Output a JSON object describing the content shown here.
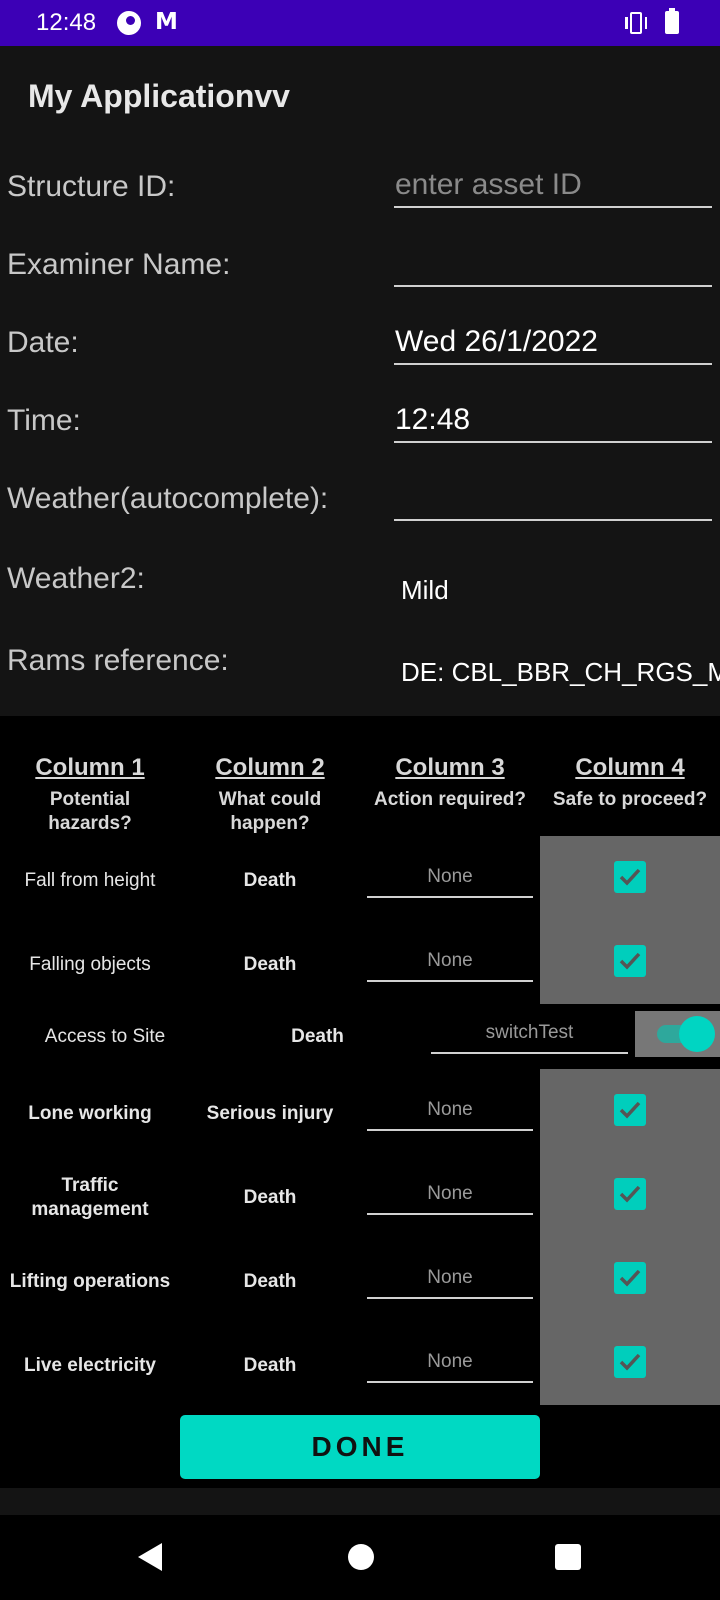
{
  "status_bar": {
    "time": "12:48",
    "mail_icon_glyph": "M",
    "icons": [
      "pocket-casts-icon",
      "gmail-icon",
      "vibrate-icon",
      "battery-icon"
    ]
  },
  "app": {
    "title": "My Applicationvv"
  },
  "form": {
    "structure_id": {
      "label": "Structure ID:",
      "placeholder": "enter asset ID",
      "value": ""
    },
    "examiner_name": {
      "label": "Examiner Name:",
      "value": ""
    },
    "date": {
      "label": "Date:",
      "value": "Wed 26/1/2022"
    },
    "time": {
      "label": "Time:",
      "value": "12:48"
    },
    "weather_auto": {
      "label": "Weather(autocomplete):",
      "value": ""
    },
    "weather2": {
      "label": "Weather2:",
      "value": "Mild"
    },
    "rams": {
      "label": "Rams reference:",
      "value": "DE: CBL_BBR_CH_RGS_M"
    }
  },
  "table": {
    "columns": [
      {
        "title": "Column 1",
        "subtitle_1": "Potential",
        "subtitle_2": "hazards?"
      },
      {
        "title": "Column 2",
        "subtitle_1": "What could",
        "subtitle_2": "happen?"
      },
      {
        "title": "Column 3",
        "subtitle_1": "Action  required?",
        "subtitle_2": ""
      },
      {
        "title": "Column 4",
        "subtitle_1": "Safe to  proceed?",
        "subtitle_2": ""
      }
    ],
    "rows": [
      {
        "hazard": "Fall from height",
        "outcome": "Death",
        "action": "None",
        "safe": true
      },
      {
        "hazard": "Falling objects",
        "outcome": "Death",
        "action": "None",
        "safe": true
      },
      {
        "hazard": "Access to Site",
        "outcome": "Death",
        "action": "switchTest",
        "safe": true
      },
      {
        "hazard": "Lone working",
        "outcome": "Serious injury",
        "action": "None",
        "safe": true
      },
      {
        "hazard_1": "Traffic",
        "hazard_2": "management",
        "outcome": "Death",
        "action": "None",
        "safe": true
      },
      {
        "hazard": "Lifting operations",
        "outcome": "Death",
        "action": "None",
        "safe": true
      },
      {
        "hazard": "Live electricity",
        "outcome": "Death",
        "action": "None",
        "safe": true
      }
    ]
  },
  "done_button": {
    "label": "DONE"
  },
  "colors": {
    "status_bar": "#3c00b6",
    "accent": "#00d9c3",
    "grey_cell": "#666666",
    "form_bg": "#141414"
  }
}
